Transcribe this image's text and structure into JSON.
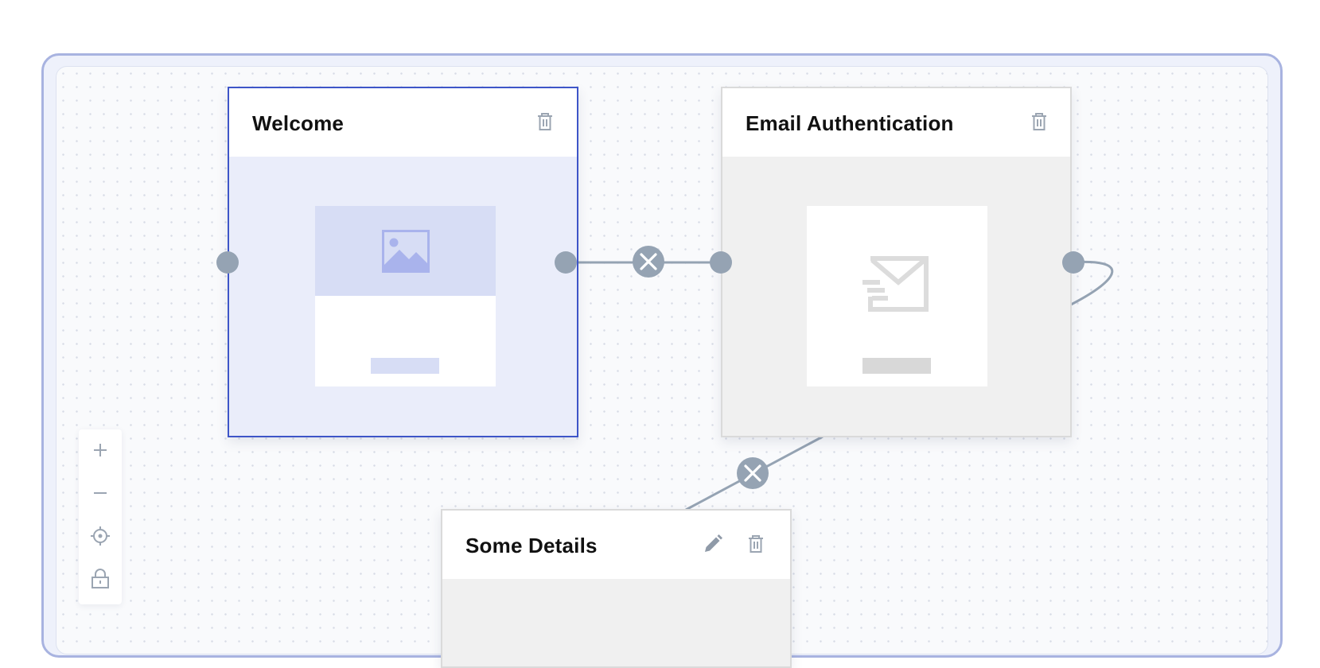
{
  "nodes": {
    "welcome": {
      "title": "Welcome",
      "delete_icon": "trash-icon",
      "thumbnail_icon": "image-icon",
      "selected": true,
      "accent": "#3e55c8"
    },
    "email_auth": {
      "title": "Email Authentication",
      "delete_icon": "trash-icon",
      "thumbnail_icon": "mail-send-icon"
    },
    "some_details": {
      "title": "Some Details",
      "edit_icon": "pencil-icon",
      "delete_icon": "trash-icon"
    }
  },
  "edges": [
    {
      "from": "welcome",
      "to": "email_auth",
      "remove_icon": "close-icon"
    },
    {
      "from": "email_auth",
      "to": "some_details",
      "remove_icon": "close-icon"
    }
  ],
  "toolbar": [
    "zoom-in-icon",
    "zoom-out-icon",
    "fit-view-icon",
    "lock-icon"
  ],
  "colors": {
    "frame_border": "#a8b3e0",
    "selected_border": "#3e55c8",
    "handle": "#95a3b3",
    "welcome_body": "#eaedfa",
    "email_body": "#f0f0f0"
  }
}
